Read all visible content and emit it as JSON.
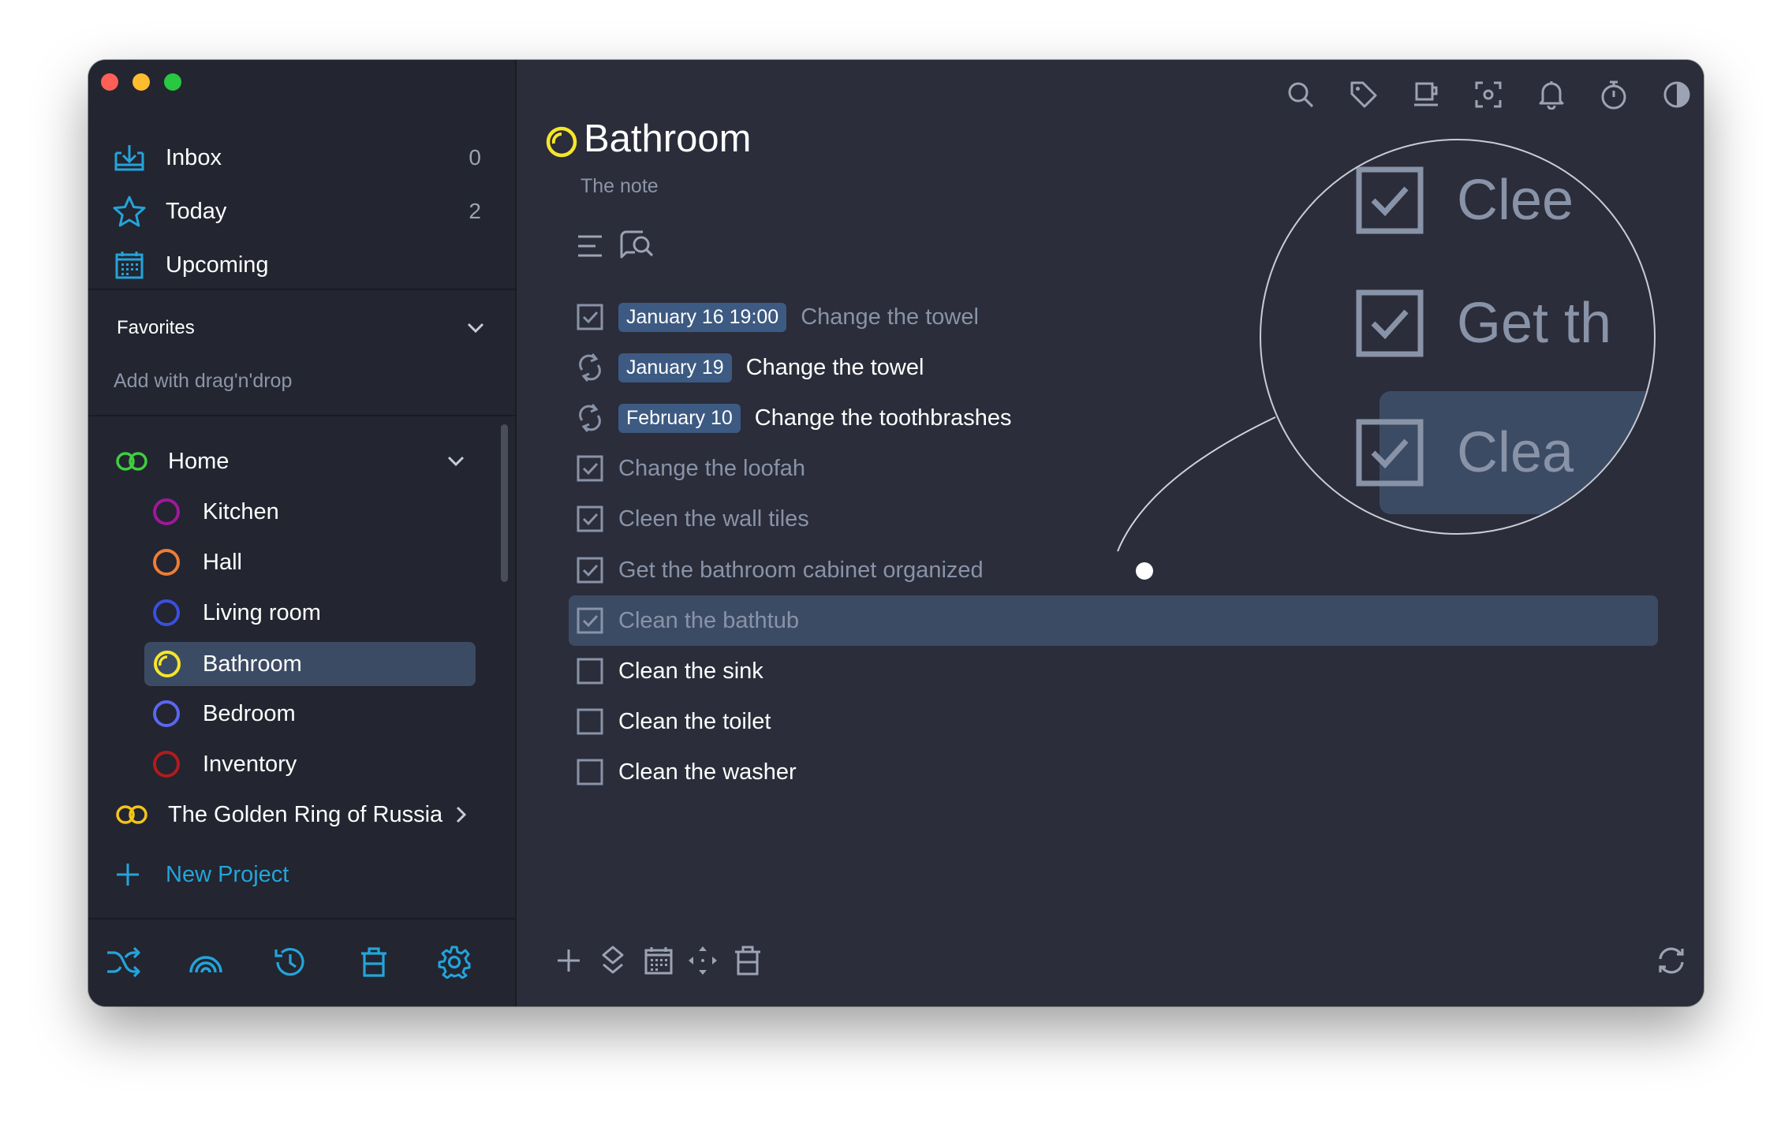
{
  "sidebar": {
    "nav": [
      {
        "label": "Inbox",
        "count": "0",
        "icon": "inbox-icon"
      },
      {
        "label": "Today",
        "count": "2",
        "icon": "star-icon"
      },
      {
        "label": "Upcoming",
        "count": "",
        "icon": "calendar-icon"
      }
    ],
    "favorites": {
      "title": "Favorites",
      "hint": "Add with drag'n'drop"
    },
    "projects": [
      {
        "label": "Home",
        "icon": "link-rings-icon",
        "color": "#3ecf3e"
      },
      {
        "label": "Kitchen",
        "color": "#a0189b"
      },
      {
        "label": "Hall",
        "color": "#ef7d34"
      },
      {
        "label": "Living room",
        "color": "#3b4fe0"
      },
      {
        "label": "Bathroom",
        "color": "#f5e62a"
      },
      {
        "label": "Bedroom",
        "color": "#5b66f0"
      },
      {
        "label": "Inventory",
        "color": "#b01c1c"
      },
      {
        "label": "The Golden Ring of Russia",
        "icon": "link-rings-icon",
        "color": "#f5c518"
      }
    ],
    "new_project": "New Project"
  },
  "main": {
    "title": "Bathroom",
    "note": "The note",
    "tasks": [
      {
        "badge": "January 16 19:00",
        "text": "Change the towel",
        "state": "done"
      },
      {
        "badge": "January 19",
        "text": "Change the towel",
        "state": "repeat"
      },
      {
        "badge": "February 10",
        "text": "Change the toothbrashes",
        "state": "repeat"
      },
      {
        "text": "Change the loofah",
        "state": "done"
      },
      {
        "text": "Cleen the wall tiles",
        "state": "done"
      },
      {
        "text": "Get the bathroom cabinet organized",
        "state": "done"
      },
      {
        "text": "Clean the bathtub",
        "state": "done",
        "selected": true
      },
      {
        "text": "Clean the sink",
        "state": "open"
      },
      {
        "text": "Clean the toilet",
        "state": "open"
      },
      {
        "text": "Clean the washer",
        "state": "open"
      }
    ],
    "magnifier": [
      {
        "text": "Clee"
      },
      {
        "text": "Get th"
      },
      {
        "text": "Clea"
      }
    ]
  },
  "colors": {
    "accent": "#24a4da",
    "sidebar_bg": "#232530",
    "main_bg": "#2b2d3a",
    "selection": "#3c4b64",
    "badge": "#3d5a82"
  }
}
